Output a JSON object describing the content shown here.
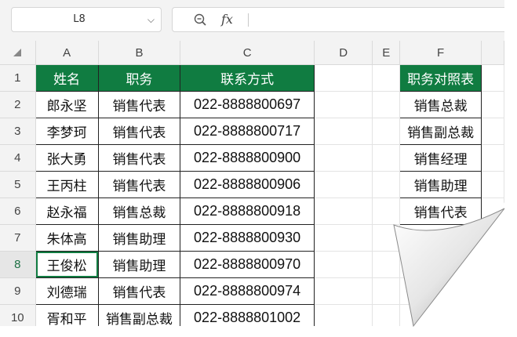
{
  "namebox": {
    "value": "L8",
    "chevron": "⌵"
  },
  "formula_bar": {
    "fx_label": "fx",
    "value": ""
  },
  "columns": [
    "A",
    "B",
    "C",
    "D",
    "E",
    "F"
  ],
  "rows": [
    {
      "num": "1",
      "a": "姓名",
      "b": "职务",
      "c": "联系方式",
      "f": "职务对照表"
    },
    {
      "num": "2",
      "a": "郎永坚",
      "b": "销售代表",
      "c": "022-8888800697",
      "f": "销售总裁"
    },
    {
      "num": "3",
      "a": "李梦珂",
      "b": "销售代表",
      "c": "022-8888800717",
      "f": "销售副总裁"
    },
    {
      "num": "4",
      "a": "张大勇",
      "b": "销售代表",
      "c": "022-8888800900",
      "f": "销售经理"
    },
    {
      "num": "5",
      "a": "王丙柱",
      "b": "销售代表",
      "c": "022-8888800906",
      "f": "销售助理"
    },
    {
      "num": "6",
      "a": "赵永福",
      "b": "销售总裁",
      "c": "022-8888800918",
      "f": "销售代表"
    },
    {
      "num": "7",
      "a": "朱体高",
      "b": "销售助理",
      "c": "022-8888800930",
      "f": ""
    },
    {
      "num": "8",
      "a": "王俊松",
      "b": "销售助理",
      "c": "022-8888800970",
      "f": ""
    },
    {
      "num": "9",
      "a": "刘德瑞",
      "b": "销售代表",
      "c": "022-8888800974",
      "f": ""
    },
    {
      "num": "10",
      "a": "胥和平",
      "b": "销售副总裁",
      "c": "022-8888801002",
      "f": ""
    }
  ],
  "colors": {
    "header_green": "#107c41",
    "selection": "#107c41"
  }
}
